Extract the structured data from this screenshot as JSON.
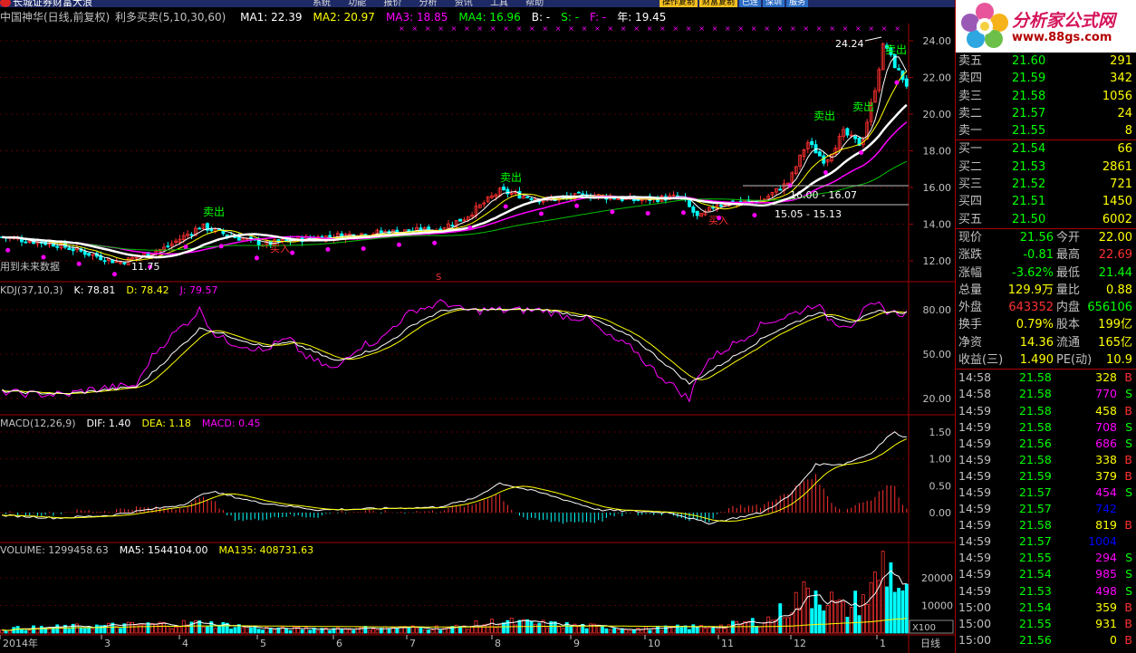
{
  "titlebar": {
    "title": "长城证券财富大浪",
    "menu": [
      "系统",
      "功能",
      "报价",
      "分析",
      "资讯",
      "工具",
      "帮助"
    ],
    "buttons": [
      "操作复制",
      "财富复制",
      "已连",
      "深圳",
      "服务"
    ]
  },
  "header": {
    "stock_name": "中国神华(日线,前复权)",
    "indicator": "利多买卖(5,10,30,60)",
    "items": [
      {
        "text": "MA1: 22.39",
        "color": "#ffffff"
      },
      {
        "text": "MA2: 20.97",
        "color": "#ffff00"
      },
      {
        "text": "MA3: 18.85",
        "color": "#ff00ff"
      },
      {
        "text": "MA4: 16.96",
        "color": "#00ff00"
      },
      {
        "text": "B: -",
        "color": "#ffffff"
      },
      {
        "text": "S: -",
        "color": "#00ff00"
      },
      {
        "text": "F: -",
        "color": "#ff00ff"
      },
      {
        "text": "年: 19.45",
        "color": "#ffffff"
      }
    ]
  },
  "main_chart": {
    "y_ticks": [
      "24.00",
      "22.00",
      "20.00",
      "18.00",
      "16.00",
      "14.00",
      "12.00"
    ],
    "annotations": {
      "high": "24.24",
      "low": "11.75",
      "sell": "卖出",
      "buy": "买入",
      "future_note": "用到未来数据",
      "range1": "16.00 - 16.07",
      "range2": "15.05 - 15.13",
      "s_marker": "S"
    }
  },
  "kdj": {
    "label": "KDJ(37,10,3)",
    "items": [
      {
        "text": "K: 78.81",
        "color": "#ffffff"
      },
      {
        "text": "D: 78.42",
        "color": "#ffff00"
      },
      {
        "text": "J: 79.57",
        "color": "#ff00ff"
      }
    ],
    "y_ticks": [
      "80.00",
      "50.00",
      "20.00"
    ]
  },
  "macd": {
    "label": "MACD(12,26,9)",
    "items": [
      {
        "text": "DIF: 1.40",
        "color": "#ffffff"
      },
      {
        "text": "DEA: 1.18",
        "color": "#ffff00"
      },
      {
        "text": "MACD: 0.45",
        "color": "#ff00ff"
      }
    ],
    "y_ticks": [
      "1.50",
      "1.00",
      "0.50",
      "0.00"
    ]
  },
  "volume": {
    "label": "VOLUME: 1299458.63",
    "items": [
      {
        "text": "MA5: 1544104.00",
        "color": "#ffffff"
      },
      {
        "text": "MA135: 408731.63",
        "color": "#ffff00"
      }
    ],
    "y_ticks": [
      "20000",
      "10000"
    ],
    "unit": "X100"
  },
  "x_axis": {
    "labels": [
      "2014年",
      "3",
      "4",
      "5",
      "6",
      "7",
      "8",
      "9",
      "10",
      "11",
      "12",
      "1"
    ],
    "period": "日线"
  },
  "order_book": {
    "asks": [
      {
        "label": "卖五",
        "price": "21.60",
        "vol": "291"
      },
      {
        "label": "卖四",
        "price": "21.59",
        "vol": "342"
      },
      {
        "label": "卖三",
        "price": "21.58",
        "vol": "1056"
      },
      {
        "label": "卖二",
        "price": "21.57",
        "vol": "24"
      },
      {
        "label": "卖一",
        "price": "21.55",
        "vol": "8"
      }
    ],
    "bids": [
      {
        "label": "买一",
        "price": "21.54",
        "vol": "66"
      },
      {
        "label": "买二",
        "price": "21.53",
        "vol": "2861"
      },
      {
        "label": "买三",
        "price": "21.52",
        "vol": "721"
      },
      {
        "label": "买四",
        "price": "21.51",
        "vol": "1450"
      },
      {
        "label": "买五",
        "price": "21.50",
        "vol": "6002"
      }
    ]
  },
  "stats": [
    {
      "l1": "现价",
      "v1": "21.56",
      "c1": "#00ff00",
      "l2": "今开",
      "v2": "22.00",
      "c2": "#ffff00"
    },
    {
      "l1": "涨跌",
      "v1": "-0.81",
      "c1": "#00ff00",
      "l2": "最高",
      "v2": "22.69",
      "c2": "#ff3030"
    },
    {
      "l1": "涨幅",
      "v1": "-3.62%",
      "c1": "#00ff00",
      "l2": "最低",
      "v2": "21.44",
      "c2": "#00ff00"
    },
    {
      "l1": "总量",
      "v1": "129.9万",
      "c1": "#ffff00",
      "l2": "量比",
      "v2": "0.88",
      "c2": "#ffff00"
    },
    {
      "l1": "外盘",
      "v1": "643352",
      "c1": "#ff3030",
      "l2": "内盘",
      "v2": "656106",
      "c2": "#00ff00"
    },
    {
      "l1": "换手",
      "v1": "0.79%",
      "c1": "#ffff00",
      "l2": "股本",
      "v2": "199亿",
      "c2": "#ffff00"
    },
    {
      "l1": "净资",
      "v1": "14.36",
      "c1": "#ffff00",
      "l2": "流通",
      "v2": "165亿",
      "c2": "#ffff00"
    },
    {
      "l1": "收益(三)",
      "v1": "1.490",
      "c1": "#ffff00",
      "l2": "PE(动)",
      "v2": "10.9",
      "c2": "#ffff00"
    }
  ],
  "ticks": [
    {
      "time": "14:58",
      "price": "21.58",
      "vol": "328",
      "side": "B"
    },
    {
      "time": "14:58",
      "price": "21.58",
      "vol": "770",
      "side": "S"
    },
    {
      "time": "14:59",
      "price": "21.58",
      "vol": "458",
      "side": "B"
    },
    {
      "time": "14:59",
      "price": "21.58",
      "vol": "708",
      "side": "S"
    },
    {
      "time": "14:59",
      "price": "21.56",
      "vol": "686",
      "side": "S"
    },
    {
      "time": "14:59",
      "price": "21.58",
      "vol": "338",
      "side": "B"
    },
    {
      "time": "14:59",
      "price": "21.59",
      "vol": "379",
      "side": "B"
    },
    {
      "time": "14:59",
      "price": "21.57",
      "vol": "454",
      "side": "S"
    },
    {
      "time": "14:59",
      "price": "21.57",
      "vol": "742",
      "side": ""
    },
    {
      "time": "14:59",
      "price": "21.58",
      "vol": "819",
      "side": "B"
    },
    {
      "time": "14:59",
      "price": "21.57",
      "vol": "1004",
      "side": ""
    },
    {
      "time": "14:59",
      "price": "21.55",
      "vol": "294",
      "side": "S"
    },
    {
      "time": "14:59",
      "price": "21.54",
      "vol": "985",
      "side": "S"
    },
    {
      "time": "14:59",
      "price": "21.53",
      "vol": "498",
      "side": "S"
    },
    {
      "time": "15:00",
      "price": "21.54",
      "vol": "359",
      "side": "B"
    },
    {
      "time": "15:00",
      "price": "21.55",
      "vol": "931",
      "side": "B"
    },
    {
      "time": "15:00",
      "price": "21.56",
      "vol": "0",
      "side": "B"
    }
  ],
  "colors": {
    "up": "#ff3030",
    "down": "#00ffff",
    "grid": "#a00000",
    "ma_white": "#ffffff",
    "ma_yellow": "#ffff00",
    "ma_magenta": "#ff00ff",
    "ma_green": "#00c000",
    "sell_text": "#00ff00"
  }
}
